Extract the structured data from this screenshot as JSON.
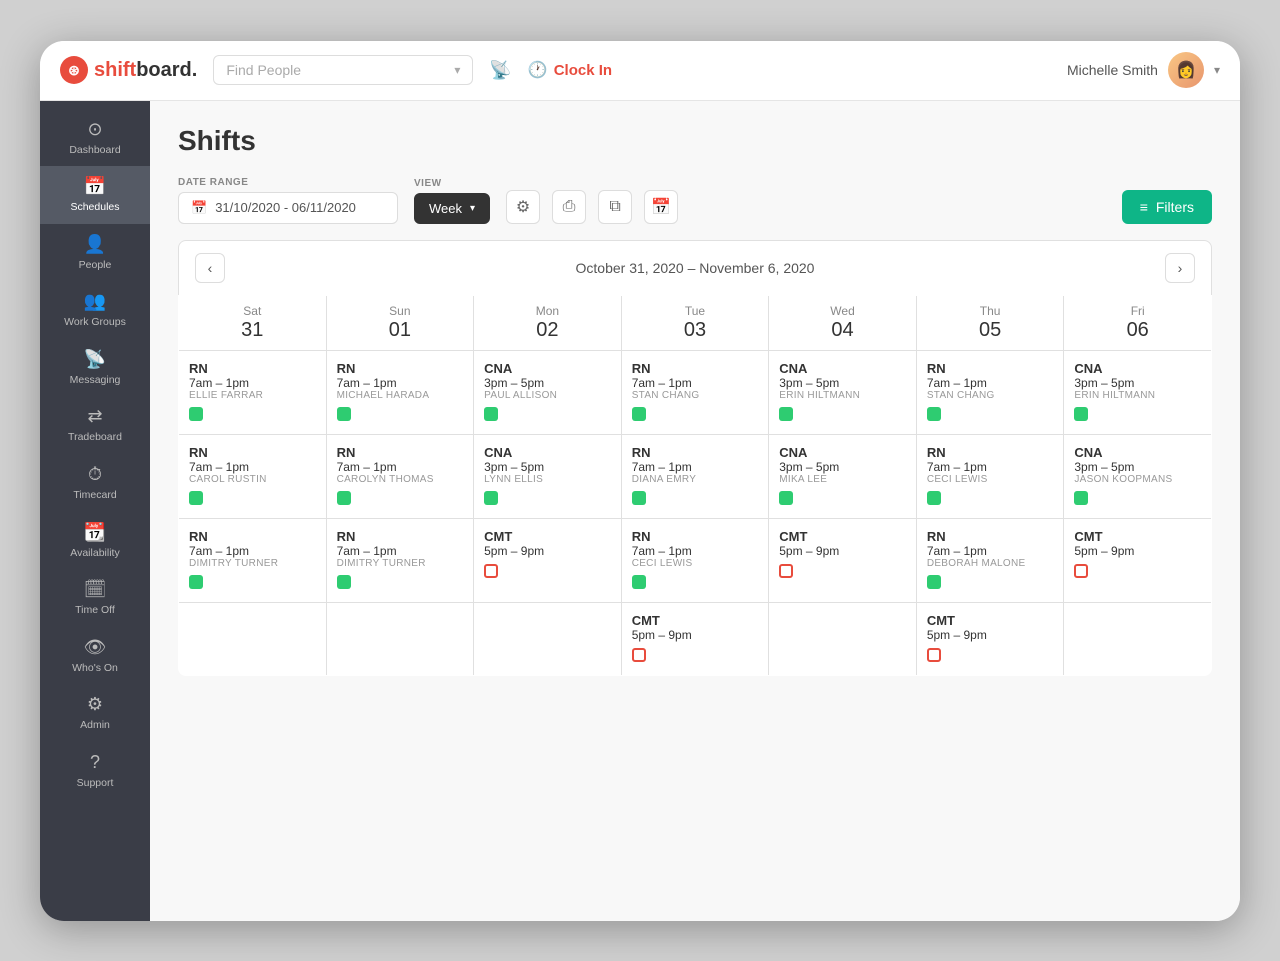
{
  "app": {
    "title": "shiftboard",
    "logo_symbol": "⊛"
  },
  "topnav": {
    "find_people_placeholder": "Find People",
    "clock_in_label": "Clock In",
    "user_name": "Michelle Smith",
    "user_avatar": "👩"
  },
  "sidebar": {
    "items": [
      {
        "id": "dashboard",
        "label": "Dashboard",
        "icon": "⊙",
        "active": false
      },
      {
        "id": "schedules",
        "label": "Schedules",
        "icon": "📅",
        "active": true
      },
      {
        "id": "people",
        "label": "People",
        "icon": "👤",
        "active": false
      },
      {
        "id": "workgroups",
        "label": "Work Groups",
        "icon": "👥",
        "active": false
      },
      {
        "id": "messaging",
        "label": "Messaging",
        "icon": "📡",
        "active": false
      },
      {
        "id": "tradeboard",
        "label": "Tradeboard",
        "icon": "⇄",
        "active": false
      },
      {
        "id": "timecard",
        "label": "Timecard",
        "icon": "⏱",
        "active": false
      },
      {
        "id": "availability",
        "label": "Availability",
        "icon": "📆",
        "active": false
      },
      {
        "id": "timeoff",
        "label": "Time Off",
        "icon": "🗓",
        "active": false
      },
      {
        "id": "whoson",
        "label": "Who's On",
        "icon": "👁",
        "active": false
      },
      {
        "id": "admin",
        "label": "Admin",
        "icon": "⚙",
        "active": false
      },
      {
        "id": "support",
        "label": "Support",
        "icon": "?",
        "active": false
      }
    ]
  },
  "page": {
    "title": "Shifts",
    "date_range_label": "DATE RANGE",
    "date_range_value": "31/10/2020 - 06/11/2020",
    "view_label": "VIEW",
    "view_value": "Week",
    "filters_label": "Filters",
    "week_display": "October 31, 2020 – November 6, 2020"
  },
  "calendar": {
    "columns": [
      {
        "day_name": "Sat",
        "day_num": "31"
      },
      {
        "day_name": "Sun",
        "day_num": "01"
      },
      {
        "day_name": "Mon",
        "day_num": "02"
      },
      {
        "day_name": "Tue",
        "day_num": "03"
      },
      {
        "day_name": "Wed",
        "day_num": "04"
      },
      {
        "day_name": "Thu",
        "day_num": "05"
      },
      {
        "day_name": "Fri",
        "day_num": "06"
      }
    ],
    "rows": [
      [
        {
          "role": "RN",
          "time": "7am – 1pm",
          "name": "ELLIE FARRAR",
          "status": "green"
        },
        {
          "role": "RN",
          "time": "7am – 1pm",
          "name": "MICHAEL HARADA",
          "status": "green"
        },
        {
          "role": "CNA",
          "time": "3pm – 5pm",
          "name": "PAUL ALLISON",
          "status": "green"
        },
        {
          "role": "RN",
          "time": "7am – 1pm",
          "name": "STAN CHANG",
          "status": "green"
        },
        {
          "role": "CNA",
          "time": "3pm – 5pm",
          "name": "ERIN HILTMANN",
          "status": "green"
        },
        {
          "role": "RN",
          "time": "7am – 1pm",
          "name": "STAN CHANG",
          "status": "green"
        },
        {
          "role": "CNA",
          "time": "3pm – 5pm",
          "name": "ERIN HILTMANN",
          "status": "green"
        }
      ],
      [
        {
          "role": "RN",
          "time": "7am – 1pm",
          "name": "CAROL RUSTIN",
          "status": "green"
        },
        {
          "role": "RN",
          "time": "7am – 1pm",
          "name": "CAROLYN THOMAS",
          "status": "green"
        },
        {
          "role": "CNA",
          "time": "3pm – 5pm",
          "name": "LYNN ELLIS",
          "status": "green"
        },
        {
          "role": "RN",
          "time": "7am – 1pm",
          "name": "DIANA EMRY",
          "status": "green"
        },
        {
          "role": "CNA",
          "time": "3pm – 5pm",
          "name": "MIKA LEE",
          "status": "green"
        },
        {
          "role": "RN",
          "time": "7am – 1pm",
          "name": "CECI LEWIS",
          "status": "green"
        },
        {
          "role": "CNA",
          "time": "3pm – 5pm",
          "name": "JASON KOOPMANS",
          "status": "green"
        }
      ],
      [
        {
          "role": "RN",
          "time": "7am – 1pm",
          "name": "DIMITRY TURNER",
          "status": "green"
        },
        {
          "role": "RN",
          "time": "7am – 1pm",
          "name": "DIMITRY TURNER",
          "status": "green"
        },
        {
          "role": "CMT",
          "time": "5pm – 9pm",
          "name": "",
          "status": "red-outline"
        },
        {
          "role": "RN",
          "time": "7am – 1pm",
          "name": "CECI LEWIS",
          "status": "green"
        },
        {
          "role": "CMT",
          "time": "5pm – 9pm",
          "name": "",
          "status": "red-outline"
        },
        {
          "role": "RN",
          "time": "7am – 1pm",
          "name": "DEBORAH MALONE",
          "status": "green"
        },
        {
          "role": "CMT",
          "time": "5pm – 9pm",
          "name": "",
          "status": "red-outline"
        }
      ],
      [
        {
          "role": "",
          "time": "",
          "name": "",
          "status": ""
        },
        {
          "role": "",
          "time": "",
          "name": "",
          "status": ""
        },
        {
          "role": "",
          "time": "",
          "name": "",
          "status": ""
        },
        {
          "role": "CMT",
          "time": "5pm – 9pm",
          "name": "",
          "status": "red-outline"
        },
        {
          "role": "",
          "time": "",
          "name": "",
          "status": ""
        },
        {
          "role": "CMT",
          "time": "5pm – 9pm",
          "name": "",
          "status": "red-outline"
        },
        {
          "role": "",
          "time": "",
          "name": "",
          "status": ""
        }
      ]
    ]
  }
}
